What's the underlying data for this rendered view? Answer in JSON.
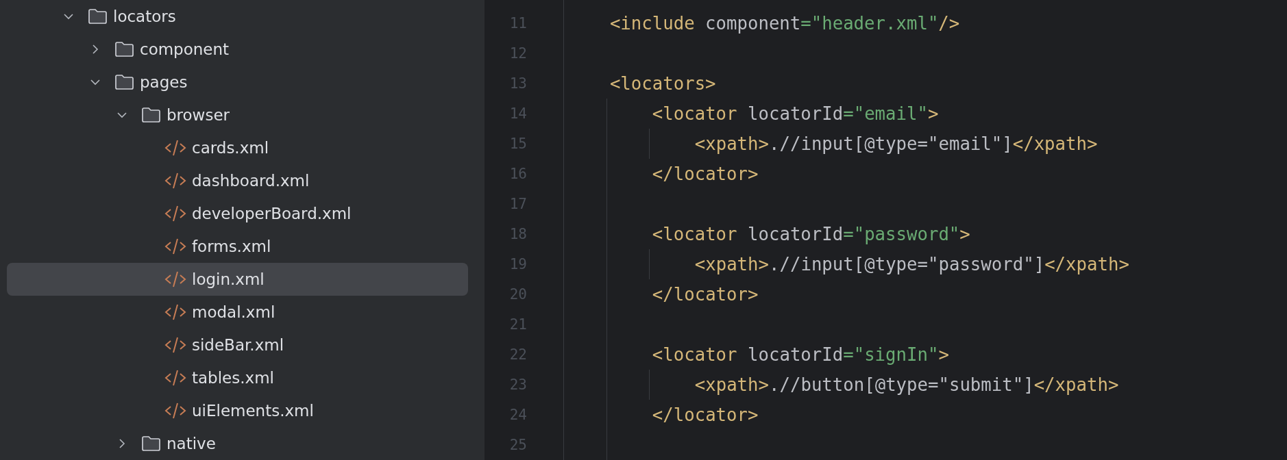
{
  "project_tree": [
    {
      "name": "locators",
      "kind": "folder",
      "expanded": true,
      "selected": false,
      "children": [
        {
          "name": "component",
          "kind": "folder",
          "expanded": false,
          "selected": false
        },
        {
          "name": "pages",
          "kind": "folder",
          "expanded": true,
          "selected": false,
          "children": [
            {
              "name": "browser",
              "kind": "folder",
              "expanded": true,
              "selected": false,
              "children": [
                {
                  "name": "cards.xml",
                  "kind": "file",
                  "selected": false
                },
                {
                  "name": "dashboard.xml",
                  "kind": "file",
                  "selected": false
                },
                {
                  "name": "developerBoard.xml",
                  "kind": "file",
                  "selected": false
                },
                {
                  "name": "forms.xml",
                  "kind": "file",
                  "selected": false
                },
                {
                  "name": "login.xml",
                  "kind": "file",
                  "selected": true
                },
                {
                  "name": "modal.xml",
                  "kind": "file",
                  "selected": false
                },
                {
                  "name": "sideBar.xml",
                  "kind": "file",
                  "selected": false
                },
                {
                  "name": "tables.xml",
                  "kind": "file",
                  "selected": false
                },
                {
                  "name": "uiElements.xml",
                  "kind": "file",
                  "selected": false
                }
              ]
            },
            {
              "name": "native",
              "kind": "folder",
              "expanded": false,
              "selected": false
            }
          ]
        }
      ]
    }
  ],
  "editor": {
    "lines": [
      {
        "number": "11",
        "tokens": [
          {
            "kind": "tag",
            "text": "<include"
          },
          {
            "kind": "plain",
            "text": " component"
          },
          {
            "kind": "string",
            "text": "=\"header.xml\""
          },
          {
            "kind": "tag",
            "text": "/>"
          }
        ]
      },
      {
        "number": "12"
      },
      {
        "number": "13",
        "tokens": [
          {
            "kind": "tag",
            "text": "<locators>"
          }
        ],
        "children": [
          {
            "number": "14",
            "tokens": [
              {
                "kind": "tag",
                "text": "<locator"
              },
              {
                "kind": "plain",
                "text": " locatorId"
              },
              {
                "kind": "string",
                "text": "=\"email\""
              },
              {
                "kind": "tag",
                "text": ">"
              }
            ],
            "children": [
              {
                "number": "15",
                "tokens": [
                  {
                    "kind": "tag",
                    "text": "<xpath>"
                  },
                  {
                    "kind": "plain",
                    "text": ".//input[@type=\"email\"]"
                  },
                  {
                    "kind": "tag",
                    "text": "</xpath>"
                  }
                ]
              }
            ]
          },
          {
            "number": "16",
            "tokens": [
              {
                "kind": "tag",
                "text": "</locator>"
              }
            ]
          },
          {
            "number": "17"
          },
          {
            "number": "18",
            "tokens": [
              {
                "kind": "tag",
                "text": "<locator"
              },
              {
                "kind": "plain",
                "text": " locatorId"
              },
              {
                "kind": "string",
                "text": "=\"password\""
              },
              {
                "kind": "tag",
                "text": ">"
              }
            ],
            "children": [
              {
                "number": "19",
                "tokens": [
                  {
                    "kind": "tag",
                    "text": "<xpath>"
                  },
                  {
                    "kind": "plain",
                    "text": ".//input[@type=\"password\"]"
                  },
                  {
                    "kind": "tag",
                    "text": "</xpath>"
                  }
                ]
              }
            ]
          },
          {
            "number": "20",
            "tokens": [
              {
                "kind": "tag",
                "text": "</locator>"
              }
            ]
          },
          {
            "number": "21"
          },
          {
            "number": "22",
            "tokens": [
              {
                "kind": "tag",
                "text": "<locator"
              },
              {
                "kind": "plain",
                "text": " locatorId"
              },
              {
                "kind": "string",
                "text": "=\"signIn\""
              },
              {
                "kind": "tag",
                "text": ">"
              }
            ],
            "children": [
              {
                "number": "23",
                "tokens": [
                  {
                    "kind": "tag",
                    "text": "<xpath>"
                  },
                  {
                    "kind": "plain",
                    "text": ".//button[@type=\"submit\"]"
                  },
                  {
                    "kind": "tag",
                    "text": "</xpath>"
                  }
                ]
              }
            ]
          },
          {
            "number": "24",
            "tokens": [
              {
                "kind": "tag",
                "text": "</locator>"
              }
            ]
          },
          {
            "number": "25"
          }
        ]
      }
    ]
  }
}
